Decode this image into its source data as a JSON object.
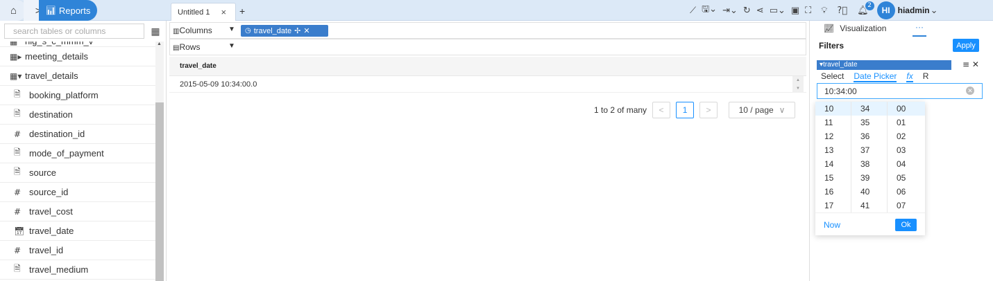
{
  "breadcrumb": {
    "home_icon": "home-icon",
    "separator": ">",
    "reports_label": "Reports"
  },
  "tabs": [
    {
      "label": "Untitled 1",
      "close": "×"
    }
  ],
  "tab_add": "+",
  "user": {
    "initials": "HI",
    "name": "hiadmin",
    "notifications": "2"
  },
  "left_panel": {
    "search_placeholder": "search tables or columns",
    "tables": [
      {
        "name": "meeting_details",
        "expanded": false
      },
      {
        "name": "travel_details",
        "expanded": true
      }
    ],
    "partial_label": "hig_s_c_mmm_v",
    "fields": [
      {
        "name": "booking_platform",
        "type": "text"
      },
      {
        "name": "destination",
        "type": "text"
      },
      {
        "name": "destination_id",
        "type": "number"
      },
      {
        "name": "mode_of_payment",
        "type": "text"
      },
      {
        "name": "source",
        "type": "text"
      },
      {
        "name": "source_id",
        "type": "number"
      },
      {
        "name": "travel_cost",
        "type": "number"
      },
      {
        "name": "travel_date",
        "type": "date"
      },
      {
        "name": "travel_id",
        "type": "number"
      },
      {
        "name": "travel_medium",
        "type": "text"
      }
    ]
  },
  "shelves": {
    "columns_label": "Columns",
    "rows_label": "Rows",
    "column_pill": "travel_date"
  },
  "grid": {
    "header": "travel_date",
    "rows": [
      "2015-05-09 10:34:00.0"
    ]
  },
  "pager": {
    "summary": "1 to 2 of many",
    "prev": "<",
    "current": "1",
    "next": ">",
    "page_size": "10 / page"
  },
  "right_panel": {
    "viz_label": "Visualization",
    "more_label": "···",
    "filters_title": "Filters",
    "apply_label": "Apply",
    "filter_name": "travel_date",
    "modes": [
      "Select",
      "Date Picker",
      "fx",
      "R"
    ],
    "time_value": "10:34:00"
  },
  "time_picker": {
    "hours": [
      "10",
      "11",
      "12",
      "13",
      "14",
      "15",
      "16",
      "17"
    ],
    "minutes": [
      "34",
      "35",
      "36",
      "37",
      "38",
      "39",
      "40",
      "41"
    ],
    "seconds": [
      "00",
      "01",
      "02",
      "03",
      "04",
      "05",
      "06",
      "07"
    ],
    "now_label": "Now",
    "ok_label": "Ok"
  },
  "colors": {
    "accent": "#2f84d8",
    "link": "#1890ff",
    "pill": "#3a7dcc"
  }
}
